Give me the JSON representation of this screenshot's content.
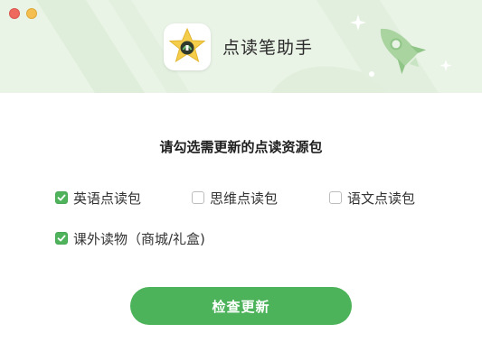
{
  "window": {
    "app_title": "点读笔助手"
  },
  "main": {
    "prompt": "请勾选需更新的点读资源包",
    "options": [
      {
        "label": "英语点读包",
        "checked": true
      },
      {
        "label": "思维点读包",
        "checked": false
      },
      {
        "label": "语文点读包",
        "checked": false
      },
      {
        "label": "课外读物（商城/礼盒)",
        "checked": true
      }
    ],
    "update_button": "检查更新"
  },
  "colors": {
    "header_bg": "#e9f3e6",
    "accent_green": "#4cb35a",
    "checkbox_checked": "#4eb35b",
    "icon_star": "#f4cd4a",
    "close_light": "#ee6a5f",
    "minimize_light": "#f5bf4f"
  },
  "icons": [
    "close-window-icon",
    "minimize-window-icon",
    "star-app-icon",
    "rocket-icon",
    "sparkle-icon",
    "checkmark-icon"
  ]
}
